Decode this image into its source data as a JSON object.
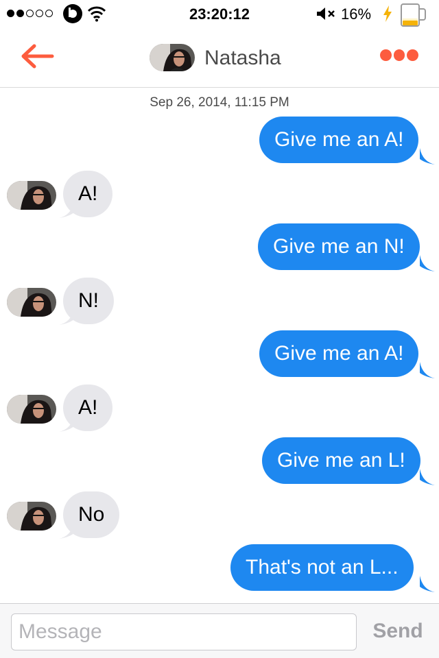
{
  "status_bar": {
    "time": "23:20:12",
    "battery_percent": "16%",
    "signal_bars_filled": 2,
    "signal_bars_total": 5,
    "icons": [
      "beats-icon",
      "wifi-icon",
      "mute-icon",
      "charging-bolt-icon",
      "beer-battery-icon"
    ]
  },
  "nav": {
    "title": "Natasha",
    "back_icon": "arrow-left-icon",
    "more_icon": "ellipsis-icon",
    "accent_color": "#fd5c3e"
  },
  "thread": {
    "timestamp": "Sep 26, 2014, 11:15 PM",
    "messages": [
      {
        "direction": "outgoing",
        "text": "Give me an A!"
      },
      {
        "direction": "incoming",
        "text": "A!"
      },
      {
        "direction": "outgoing",
        "text": "Give me an N!"
      },
      {
        "direction": "incoming",
        "text": "N!"
      },
      {
        "direction": "outgoing",
        "text": "Give me an A!"
      },
      {
        "direction": "incoming",
        "text": "A!"
      },
      {
        "direction": "outgoing",
        "text": "Give me an L!"
      },
      {
        "direction": "incoming",
        "text": "No"
      },
      {
        "direction": "outgoing",
        "text": "That's not an L..."
      }
    ],
    "outgoing_color": "#1e88f0",
    "incoming_color": "#e7e7eb"
  },
  "composer": {
    "placeholder": "Message",
    "value": "",
    "send_label": "Send"
  }
}
